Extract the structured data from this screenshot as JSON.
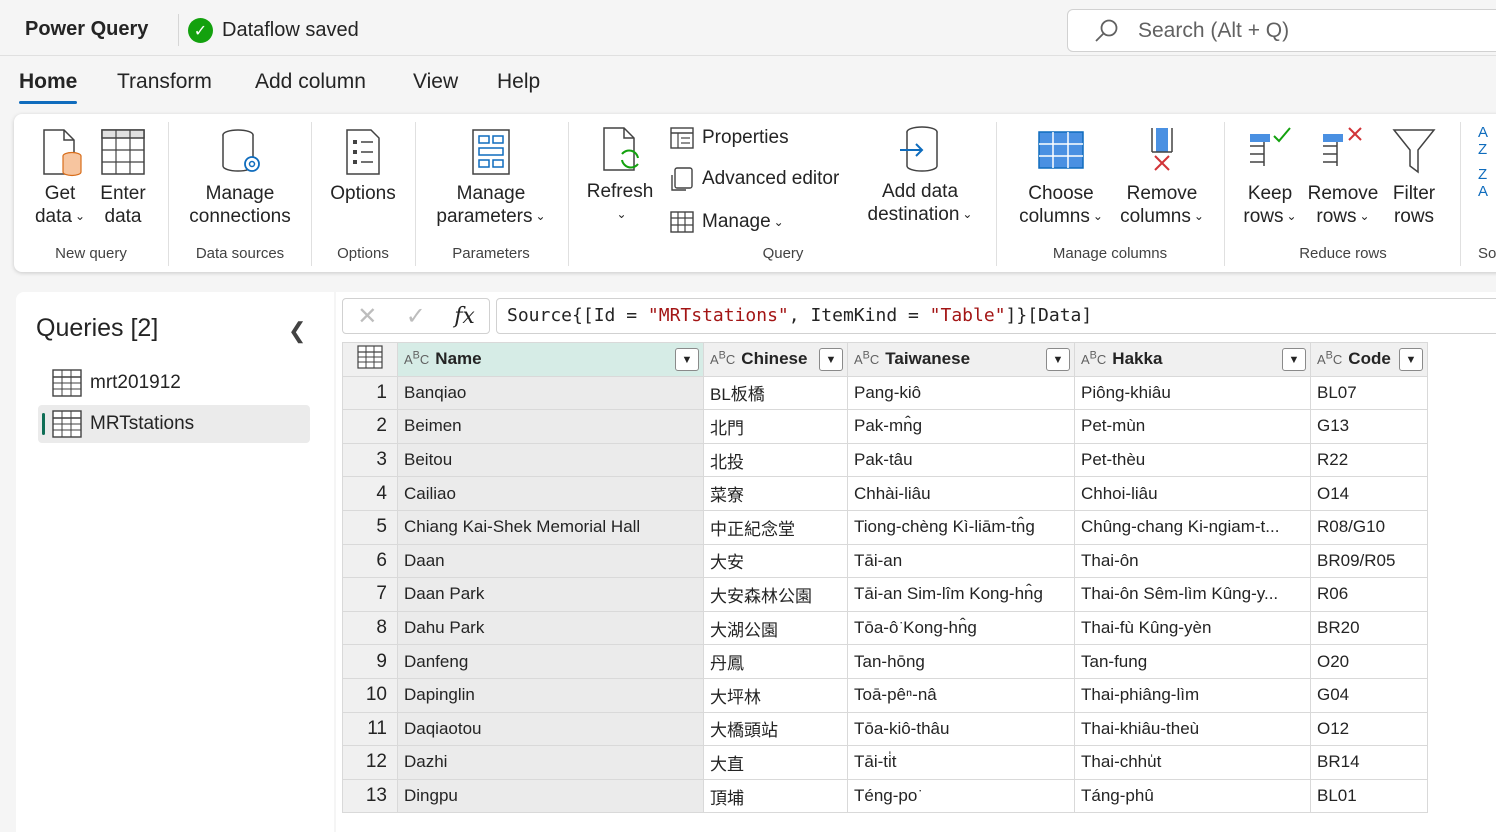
{
  "app": {
    "title": "Power Query",
    "status": "Dataflow saved"
  },
  "search": {
    "placeholder": "Search (Alt + Q)"
  },
  "tabs": [
    {
      "label": "Home",
      "active": true
    },
    {
      "label": "Transform"
    },
    {
      "label": "Add column"
    },
    {
      "label": "View"
    },
    {
      "label": "Help"
    }
  ],
  "ribbon": {
    "get_data": [
      "Get",
      "data"
    ],
    "enter_data": [
      "Enter",
      "data"
    ],
    "manage_connections": [
      "Manage",
      "connections"
    ],
    "options": "Options",
    "manage_parameters": [
      "Manage",
      "parameters"
    ],
    "refresh": "Refresh",
    "properties": "Properties",
    "advanced_editor": "Advanced editor",
    "manage": "Manage",
    "add_data_destination": [
      "Add data",
      "destination"
    ],
    "choose_columns": [
      "Choose",
      "columns"
    ],
    "remove_columns": [
      "Remove",
      "columns"
    ],
    "keep_rows": [
      "Keep",
      "rows"
    ],
    "remove_rows": [
      "Remove",
      "rows"
    ],
    "filter_rows": [
      "Filter",
      "rows"
    ],
    "sort_partial": "So",
    "groups": {
      "new_query": "New query",
      "data_sources": "Data sources",
      "options": "Options",
      "parameters": "Parameters",
      "query": "Query",
      "manage_columns": "Manage columns",
      "reduce_rows": "Reduce rows"
    }
  },
  "queries": {
    "title": "Queries [2]",
    "items": [
      {
        "label": "mrt201912",
        "selected": false
      },
      {
        "label": "MRTstations",
        "selected": true
      }
    ]
  },
  "formula": {
    "prefix": "Source{[Id = ",
    "str1": "\"MRTstations\"",
    "middle": ", ItemKind = ",
    "str2": "\"Table\"",
    "suffix": "]}[Data]"
  },
  "table": {
    "columns": [
      "Name",
      "Chinese",
      "Taiwanese",
      "Hakka",
      "Code"
    ],
    "rows": [
      [
        "1",
        "Banqiao",
        "BL板橋",
        "Pang-kiô",
        "Piông-khiâu",
        "BL07"
      ],
      [
        "2",
        "Beimen",
        "北門",
        "Pak-mn̂g",
        "Pet-mùn",
        "G13"
      ],
      [
        "3",
        "Beitou",
        "北投",
        "Pak-tâu",
        "Pet-thèu",
        "R22"
      ],
      [
        "4",
        "Cailiao",
        "菜寮",
        "Chhài-liâu",
        "Chhoi-liâu",
        "O14"
      ],
      [
        "5",
        "Chiang Kai-Shek Memorial Hall",
        "中正紀念堂",
        "Tiong-chèng Kì-liām-tn̂g",
        "Chûng-chang Ki-ngiam-t...",
        "R08/G10"
      ],
      [
        "6",
        "Daan",
        "大安",
        "Tāi-an",
        "Thai-ôn",
        "BR09/R05"
      ],
      [
        "7",
        "Daan Park",
        "大安森林公園",
        "Tāi-an Sim-lîm Kong-hn̂g",
        "Thai-ôn Sêm-lìm Kûng-y...",
        "R06"
      ],
      [
        "8",
        "Dahu Park",
        "大湖公園",
        "Tōa-ô͘ Kong-hn̂g",
        "Thai-fù Kûng-yèn",
        "BR20"
      ],
      [
        "9",
        "Danfeng",
        "丹鳳",
        "Tan-hōng",
        "Tan-fung",
        "O20"
      ],
      [
        "10",
        "Dapinglin",
        "大坪林",
        "Toā-pêⁿ-nâ",
        "Thai-phiâng-lìm",
        "G04"
      ],
      [
        "11",
        "Daqiaotou",
        "大橋頭站",
        "Tōa-kiô-thâu",
        "Thai-khiâu-theù",
        "O12"
      ],
      [
        "12",
        "Dazhi",
        "大直",
        "Tāi-ti̍t",
        "Thai-chhu̍t",
        "BR14"
      ],
      [
        "13",
        "Dingpu",
        "頂埔",
        "Téng-po͘",
        "Táng-phû",
        "BL01"
      ]
    ]
  }
}
